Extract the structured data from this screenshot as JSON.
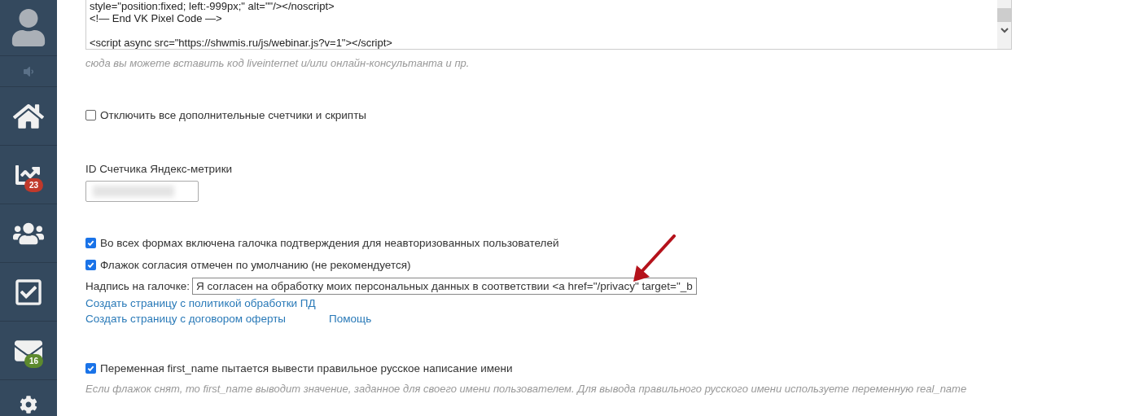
{
  "sidebar": {
    "items": [
      {
        "kind": "avatar"
      },
      {
        "kind": "sound"
      },
      {
        "kind": "home"
      },
      {
        "kind": "stats",
        "badge": "23",
        "color": "#c0392b"
      },
      {
        "kind": "users"
      },
      {
        "kind": "tasks"
      },
      {
        "kind": "mail",
        "badge": "16",
        "color": "#5d8a2e"
      },
      {
        "kind": "settings"
      }
    ]
  },
  "code_field": {
    "blocks": [
      [
        "style=\"position:fixed; left:-999px;\" alt=\"\"/></noscript>",
        "<!— End VK Pixel Code —>"
      ],
      [
        "<script async src=\"https://shwmis.ru/js/webinar.js?v=1\"></script>"
      ]
    ]
  },
  "code_hint": "сюда вы можете вставить код liveinternet и/или онлайн-консультанта и пр.",
  "disable_scripts": {
    "label": "Отключить все дополнительные счетчики и скрипты",
    "checked": false
  },
  "metrika": {
    "label": "ID Счетчика Яндекс-метрики"
  },
  "consent_options": [
    {
      "label": "Во всех формах включена галочка подтверждения для неавторизованных пользователей",
      "checked": true
    },
    {
      "label": "Флажок согласия отмечен по умолчанию (не рекомендуется)",
      "checked": true
    }
  ],
  "caption_field": {
    "label": "Надпись на галочке:",
    "value": "Я согласен на обработку моих персональных данных в соответствии <a href=\"/privacy\" target=\"_b"
  },
  "link_rows": [
    {
      "links": [
        "Создать страницу с политикой обработки ПД"
      ]
    },
    {
      "links": [
        "Создать страницу с договором оферты",
        "Помощь"
      ]
    }
  ],
  "first_name_option": {
    "label": "Переменная first_name пытается вывести правильное русское написание имени",
    "checked": true
  },
  "first_name_hint": "Если флажок снят, то first_name выводит значение, заданное для своего имени пользователем. Для вывода правильного русского имени используете переменную real_name"
}
